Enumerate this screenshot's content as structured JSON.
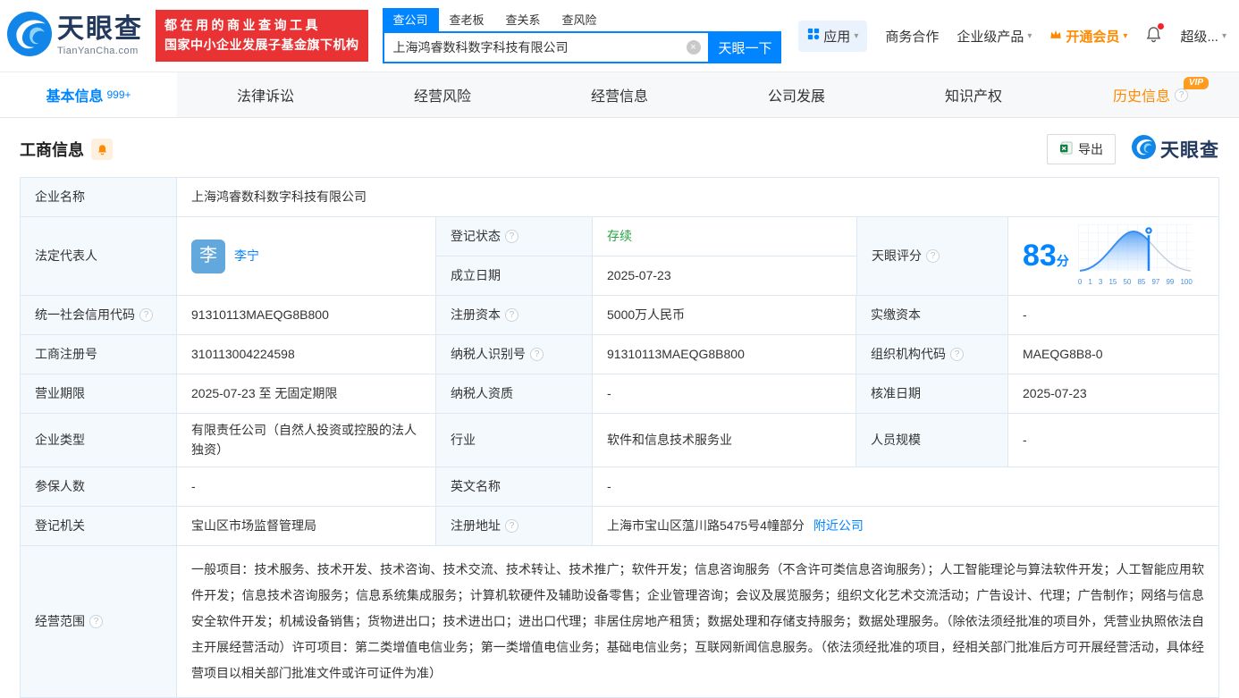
{
  "colors": {
    "accent": "#0084ff",
    "promo_red": "#e83233",
    "vip_orange": "#ff8a00",
    "status_green": "#27a343",
    "label_bg": "#f4f9fd",
    "border": "#dde8f3"
  },
  "icons": {
    "help": "?",
    "caret": "▾",
    "clear": "×"
  },
  "header": {
    "logo": {
      "title": "天眼查",
      "subtitle": "TianYanCha.com"
    },
    "promo": {
      "line1": "都在用的商业查询工具",
      "line2": "国家中小企业发展子基金旗下机构"
    },
    "search": {
      "tabs": [
        {
          "label": "查公司"
        },
        {
          "label": "查老板"
        },
        {
          "label": "查关系"
        },
        {
          "label": "查风险"
        }
      ],
      "value": "上海鸿睿数科数字科技有限公司",
      "button": "天眼一下"
    },
    "nav": {
      "apps": "应用",
      "biz": "商务合作",
      "enterprise": "企业级产品",
      "vip": "开通会员",
      "super": "超级..."
    }
  },
  "tabs": [
    {
      "label": "基本信息",
      "badge": "999+"
    },
    {
      "label": "法律诉讼"
    },
    {
      "label": "经营风险"
    },
    {
      "label": "经营信息"
    },
    {
      "label": "公司发展"
    },
    {
      "label": "知识产权"
    },
    {
      "label": "历史信息",
      "vip": "VIP"
    }
  ],
  "section": {
    "title": "工商信息",
    "export_label": "导出",
    "brand": "天眼查"
  },
  "table": {
    "company_name": {
      "label": "企业名称",
      "value": "上海鸿睿数科数字科技有限公司"
    },
    "legal_rep": {
      "label": "法定代表人",
      "avatar": "李",
      "name": "李宁"
    },
    "reg_status": {
      "label": "登记状态",
      "value": "存续"
    },
    "establish_date": {
      "label": "成立日期",
      "value": "2025-07-23"
    },
    "score": {
      "label": "天眼评分",
      "value": "83",
      "unit": "分",
      "axis": [
        "0",
        "1",
        "3",
        "15",
        "50",
        "85",
        "97",
        "99",
        "100"
      ]
    },
    "credit_code": {
      "label": "统一社会信用代码",
      "value": "91310113MAEQG8B800"
    },
    "reg_capital": {
      "label": "注册资本",
      "value": "5000万人民币"
    },
    "paid_capital": {
      "label": "实缴资本",
      "value": "-"
    },
    "reg_number": {
      "label": "工商注册号",
      "value": "310113004224598"
    },
    "taxpayer_id": {
      "label": "纳税人识别号",
      "value": "91310113MAEQG8B800"
    },
    "org_code": {
      "label": "组织机构代码",
      "value": "MAEQG8B8-0"
    },
    "business_term": {
      "label": "营业期限",
      "value": "2025-07-23 至 无固定期限"
    },
    "taxpayer_quality": {
      "label": "纳税人资质",
      "value": "-"
    },
    "approval_date": {
      "label": "核准日期",
      "value": "2025-07-23"
    },
    "company_type": {
      "label": "企业类型",
      "value": "有限责任公司（自然人投资或控股的法人独资）"
    },
    "industry": {
      "label": "行业",
      "value": "软件和信息技术服务业"
    },
    "staff_size": {
      "label": "人员规模",
      "value": "-"
    },
    "insured_count": {
      "label": "参保人数",
      "value": "-"
    },
    "english_name": {
      "label": "英文名称",
      "value": "-"
    },
    "reg_authority": {
      "label": "登记机关",
      "value": "宝山区市场监督管理局"
    },
    "reg_address": {
      "label": "注册地址",
      "value": "上海市宝山区蕰川路5475号4幢部分",
      "link": "附近公司"
    },
    "business_scope": {
      "label": "经营范围",
      "value": "一般项目：技术服务、技术开发、技术咨询、技术交流、技术转让、技术推广；软件开发；信息咨询服务（不含许可类信息咨询服务）；人工智能理论与算法软件开发；人工智能应用软件开发；信息技术咨询服务；信息系统集成服务；计算机软硬件及辅助设备零售；企业管理咨询；会议及展览服务；组织文化艺术交流活动；广告设计、代理；广告制作；网络与信息安全软件开发；机械设备销售；货物进出口；技术进出口；进出口代理；非居住房地产租赁；数据处理和存储支持服务；数据处理服务。（除依法须经批准的项目外，凭营业执照依法自主开展经营活动）许可项目：第二类增值电信业务；第一类增值电信业务；基础电信业务；互联网新闻信息服务。（依法须经批准的项目，经相关部门批准后方可开展经营活动，具体经营项目以相关部门批准文件或许可证件为准）"
    }
  }
}
